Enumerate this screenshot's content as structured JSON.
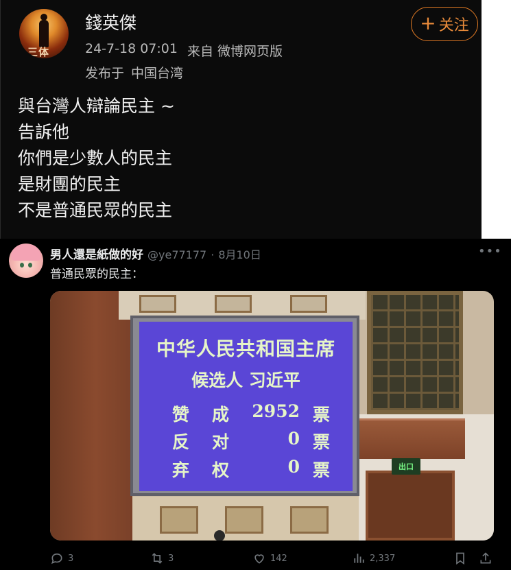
{
  "weibo": {
    "user_name": "錢英傑",
    "timestamp": "24-7-18 07:01",
    "source": "来自 微博网页版",
    "location_label": "发布于",
    "location": "中国台湾",
    "avatar_text": "三体",
    "follow_label": "关注",
    "content_lines": [
      "與台灣人辯論民主 ~",
      "告訴他",
      "你們是少數人的民主",
      "是財團的民主",
      "不是普通民眾的民主"
    ],
    "accent_color": "#e17a24"
  },
  "x_post": {
    "display_name": "男人還是紙做的好",
    "handle": "@ye77177",
    "separator": "·",
    "date": "8月10日",
    "more_icon": "more-horizontal-icon",
    "text": "普通民眾的民主：",
    "media": {
      "board_title": "中华人民共和国主席",
      "candidate": "候选人  习近平",
      "rows": [
        {
          "label1": "赞",
          "label2": "成",
          "value": "2952",
          "unit": "票"
        },
        {
          "label1": "反",
          "label2": "对",
          "value": "0",
          "unit": "票"
        },
        {
          "label1": "弃",
          "label2": "权",
          "value": "0",
          "unit": "票"
        }
      ],
      "exit_sign": "出口"
    },
    "actions": {
      "replies": "3",
      "reposts": "3",
      "likes": "142",
      "views": "2,337"
    }
  }
}
